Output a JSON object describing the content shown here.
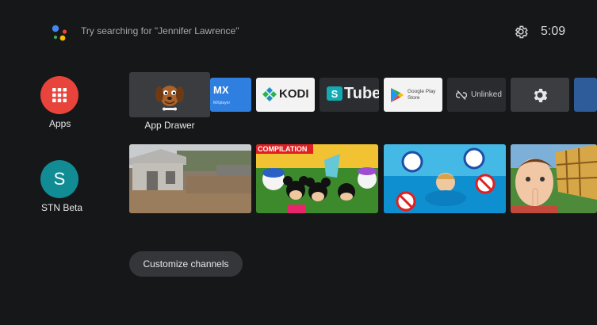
{
  "header": {
    "search_hint": "Try searching for \"Jennifer Lawrence\"",
    "time": "5:09",
    "icons": [
      "google-assistant-icon",
      "settings-icon"
    ]
  },
  "rail": {
    "apps_label": "Apps",
    "channel_label": "STN Beta",
    "channel_letter": "S"
  },
  "apps_row": {
    "focused_label": "App Drawer",
    "tiles": [
      {
        "name": "App Drawer"
      },
      {
        "name": "MX Player",
        "text": "MX",
        "subtext": "MXplayer"
      },
      {
        "name": "Kodi",
        "text": "KODI"
      },
      {
        "name": "STube",
        "text": "Tube",
        "badge": "S"
      },
      {
        "name": "Google Play Store",
        "text_line1": "Google Play",
        "text_line2": "Store"
      },
      {
        "name": "Unlinked",
        "text": "Unlinked"
      },
      {
        "name": "Settings"
      }
    ]
  },
  "video_row": {
    "compilation_label": "COMPILATION"
  },
  "customize_label": "Customize channels",
  "colors": {
    "background": "#161719",
    "apps_red": "#e9443b",
    "channel_teal": "#118c94",
    "button_gray": "#35363a"
  }
}
